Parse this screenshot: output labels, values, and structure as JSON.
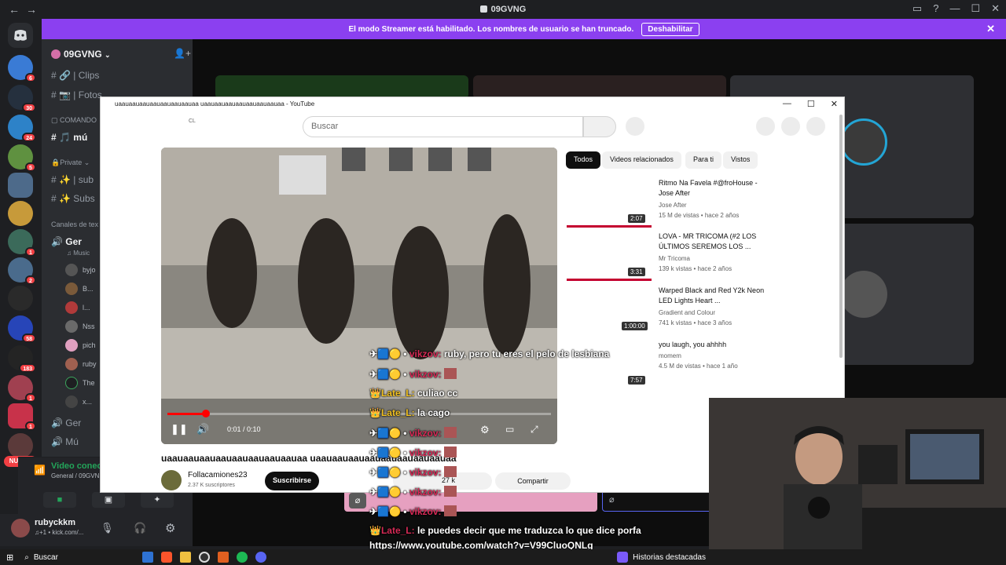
{
  "titlebar": {
    "back": "←",
    "forward": "→",
    "title": "09GVNG"
  },
  "banner": {
    "text": "El modo Streamer está habilitado. Los nombres de usuario se han truncado.",
    "button": "Deshabilitar"
  },
  "rail": {
    "badges": [
      "6",
      "30",
      "24",
      "5",
      "1",
      "2",
      "58",
      "183",
      "1",
      "1"
    ],
    "new_label": "NUEVO"
  },
  "sidebar": {
    "server_name": "09GVNG",
    "channels": [
      {
        "label": "| Clips"
      },
      {
        "label": "| Fotos"
      },
      {
        "label": "COMANDO"
      },
      {
        "label": "mú"
      },
      {
        "label": "Private"
      },
      {
        "label": "| sub"
      },
      {
        "label": "Subs"
      },
      {
        "label": "Canales de tex"
      },
      {
        "label": "Ger"
      },
      {
        "label": "Music"
      },
      {
        "label": "Ger"
      },
      {
        "label": "Mú"
      }
    ],
    "members": [
      "byjo",
      "B...",
      "l...",
      "Nss",
      "pich",
      "ruby",
      "The",
      "x..."
    ]
  },
  "voice": {
    "status": "Video conectado",
    "channel": "General / 09GVN"
  },
  "user": {
    "name": "rubyckkm",
    "status": "♫+1 • kick.com/..."
  },
  "youtube": {
    "window_title": "uaauaauaauaauaauaauaauaa uaauaauaauaauaauaauaauaa - YouTube",
    "logo_text": "CL",
    "search_placeholder": "Buscar",
    "time": "0:01 / 0:10",
    "video_title": "uaauaauaauaauaauaauaauaauaa uaauaauaauaauaauaauaauaauaa",
    "channel": "Follacamiones23",
    "subs": "2.37 K suscriptores",
    "subscribe": "Suscribirse",
    "likes": "27 k",
    "share": "Compartir",
    "chips": [
      "Todos",
      "Videos relacionados",
      "Para ti",
      "Vistos"
    ],
    "recs": [
      {
        "title": "Ritmo Na Favela #@froHouse - Jose After",
        "channel": "Jose After",
        "meta": "15 M de vistas • hace 2 años",
        "duration": "2:07"
      },
      {
        "title": "LOVA - MR TRICOMA (#2 LOS ÚLTIMOS SEREMOS LOS ...",
        "channel": "Mr Tricoma",
        "meta": "139 k vistas • hace 2 años",
        "duration": "3:31"
      },
      {
        "title": "Warped Black and Red Y2k Neon LED Lights Heart ...",
        "channel": "Gradient and Colour",
        "meta": "741 k vistas • hace 3 años",
        "duration": "1:00:00"
      },
      {
        "title": "you laugh, you ahhhh",
        "channel": "momem",
        "meta": "4.5 M de vistas • hace 1 año",
        "duration": "7:57"
      }
    ]
  },
  "chat": [
    {
      "name": "vikzov:",
      "msg": "ruby, pero tu eres el pelo de lesbiana"
    },
    {
      "name": "vikzov:",
      "msg": ""
    },
    {
      "name": "Late_L:",
      "msg": "culiao cc"
    },
    {
      "name": "Late_L:",
      "msg": "la cago"
    },
    {
      "name": "vikzov:",
      "msg": ""
    },
    {
      "name": "vikzov:",
      "msg": ""
    },
    {
      "name": "vikzov:",
      "msg": ""
    },
    {
      "name": "vikzov:",
      "msg": ""
    },
    {
      "name": "vikzov:",
      "msg": ""
    },
    {
      "name": "Late_L:",
      "msg": "le puedes decir que me traduzca lo que dice porfa"
    },
    {
      "name": "",
      "msg": "https://www.youtube.com/watch?v=V99CluoQNLg"
    }
  ],
  "taskbar": {
    "search": "Buscar",
    "news": "Historias destacadas"
  }
}
